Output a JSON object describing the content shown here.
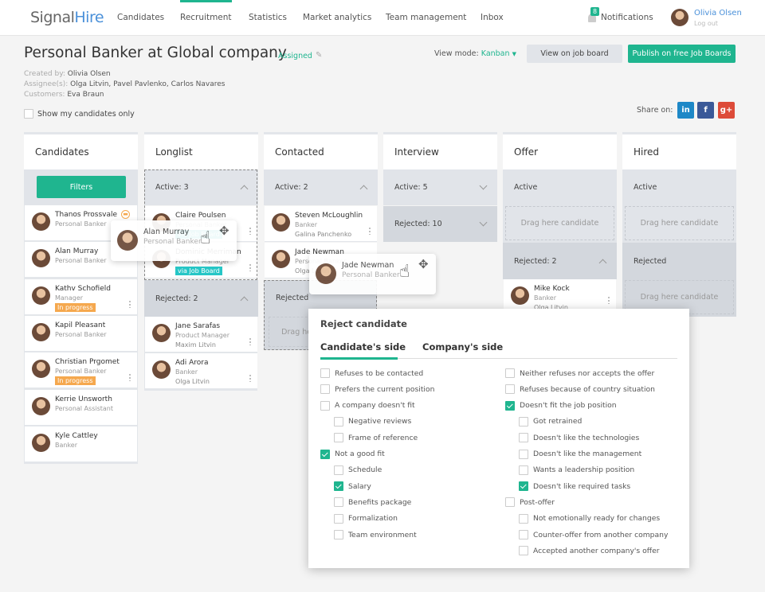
{
  "nav": {
    "logo_a": "Signal",
    "logo_b": "Hire",
    "items": [
      "Candidates",
      "Recruitment",
      "Statistics",
      "Market analytics",
      "Team management",
      "Inbox"
    ],
    "active": "Recruitment",
    "notif_count": "8",
    "notif_label": "Notifications",
    "user": "Olivia Olsen",
    "logout": "Log out"
  },
  "job": {
    "title": "Personal Banker at Global company",
    "status": "Assigned",
    "created_label": "Created by:",
    "created": "Olivia Olsen",
    "assignee_label": "Assignee(s):",
    "assignees": "Olga Litvin, Pavel Pavlenko, Carlos Navares",
    "customers_label": "Customers:",
    "customers": "Eva Braun",
    "show_mine": "Show my candidates only",
    "view_mode_label": "View mode:",
    "view_mode": "Kanban",
    "view_board": "View on job board",
    "publish": "Publish on free Job Boards",
    "share": "Share on:",
    "social": [
      "in",
      "f",
      "g+"
    ]
  },
  "colors": {
    "accent": "#1fb58f",
    "in_progress": "#f5a84e",
    "job_board": "#26c6c6"
  },
  "columns": {
    "candidates": {
      "title": "Candidates",
      "filters": "Filters",
      "cards": [
        {
          "name": "Thanos Prossvale",
          "role": "Personal Banker"
        },
        {
          "name": "Alan Murray",
          "role": "Personal Banker"
        },
        {
          "name": "Kathv Schofield",
          "role": "Manager",
          "tag": "In progress"
        },
        {
          "name": "Kapil Pleasant",
          "role": "Personal Banker"
        },
        {
          "name": "Christian Prgomet",
          "role": "Personal Banker",
          "tag": "In progress"
        },
        {
          "name": "Kerrie Unsworth",
          "role": "Personal Assistant"
        },
        {
          "name": "Kyle Cattley",
          "role": "Banker"
        }
      ]
    },
    "longlist": {
      "title": "Longlist",
      "active": "Active: 3",
      "rejected": "Rejected: 2",
      "active_cards": [
        {
          "name": "Claire Poulsen",
          "role": "Personal Banker",
          "tag": "via Job Board"
        },
        {
          "name": "Dominic Merriman",
          "role": "Product Manager",
          "tag": "via Job Board"
        }
      ],
      "rejected_cards": [
        {
          "name": "Jane Sarafas",
          "role": "Product Manager",
          "owner": "Maxim Litvin"
        },
        {
          "name": "Adi Arora",
          "role": "Banker",
          "owner": "Olga Litvin"
        }
      ]
    },
    "contacted": {
      "title": "Contacted",
      "active": "Active: 2",
      "rejected": "Rejected",
      "drag": "Drag here candidate",
      "active_cards": [
        {
          "name": "Steven McLoughlin",
          "role": "Banker",
          "owner": "Galina Panchenko"
        },
        {
          "name": "Jade Newman",
          "role": "Personal Banker",
          "owner": "Olga Litvin"
        }
      ]
    },
    "interview": {
      "title": "Interview",
      "active": "Active: 5",
      "rejected": "Rejected: 10"
    },
    "offer": {
      "title": "Offer",
      "active": "Active",
      "drag": "Drag here candidate",
      "rejected": "Rejected: 2",
      "rejected_cards": [
        {
          "name": "Mike  Kock",
          "role": "Banker",
          "owner": "Olga Litvin"
        }
      ]
    },
    "hired": {
      "title": "Hired",
      "active": "Active",
      "drag": "Drag here candidate",
      "rejected": "Rejected",
      "drag2": "Drag here candidate"
    }
  },
  "dragging": [
    {
      "name": "Alan Murray",
      "role": "Personal Banker"
    },
    {
      "name": "Jade Newman",
      "role": "Personal Banker"
    }
  ],
  "modal": {
    "title": "Reject candidate",
    "tabs": [
      "Candidate's side",
      "Company's side"
    ],
    "active_tab": "Candidate's side",
    "left": [
      {
        "label": "Refuses to be contacted",
        "checked": false,
        "indent": 0
      },
      {
        "label": "Prefers the current position",
        "checked": false,
        "indent": 0
      },
      {
        "label": "A company doesn't fit",
        "checked": false,
        "indent": 0
      },
      {
        "label": "Negative reviews",
        "checked": false,
        "indent": 1
      },
      {
        "label": "Frame of reference",
        "checked": false,
        "indent": 1
      },
      {
        "label": "Not a good fit",
        "checked": true,
        "indent": 0
      },
      {
        "label": "Schedule",
        "checked": false,
        "indent": 1
      },
      {
        "label": "Salary",
        "checked": true,
        "indent": 1
      },
      {
        "label": "Benefits package",
        "checked": false,
        "indent": 1
      },
      {
        "label": "Formalization",
        "checked": false,
        "indent": 1
      },
      {
        "label": "Team environment",
        "checked": false,
        "indent": 1
      }
    ],
    "right": [
      {
        "label": "Neither refuses nor accepts the offer",
        "checked": false,
        "indent": 0
      },
      {
        "label": "Refuses because of country situation",
        "checked": false,
        "indent": 0
      },
      {
        "label": "Doesn't fit the job position",
        "checked": true,
        "indent": 0
      },
      {
        "label": "Got retrained",
        "checked": false,
        "indent": 1
      },
      {
        "label": "Doesn't like the technologies",
        "checked": false,
        "indent": 1
      },
      {
        "label": "Doesn't like the management",
        "checked": false,
        "indent": 1
      },
      {
        "label": "Wants a leadership position",
        "checked": false,
        "indent": 1
      },
      {
        "label": "Doesn't like required tasks",
        "checked": true,
        "indent": 1
      },
      {
        "label": "Post-offer",
        "checked": false,
        "indent": 0
      },
      {
        "label": "Not emotionally ready for changes",
        "checked": false,
        "indent": 1
      },
      {
        "label": "Counter-offer from another company",
        "checked": false,
        "indent": 1
      },
      {
        "label": "Accepted another company's offer",
        "checked": false,
        "indent": 1
      }
    ]
  }
}
